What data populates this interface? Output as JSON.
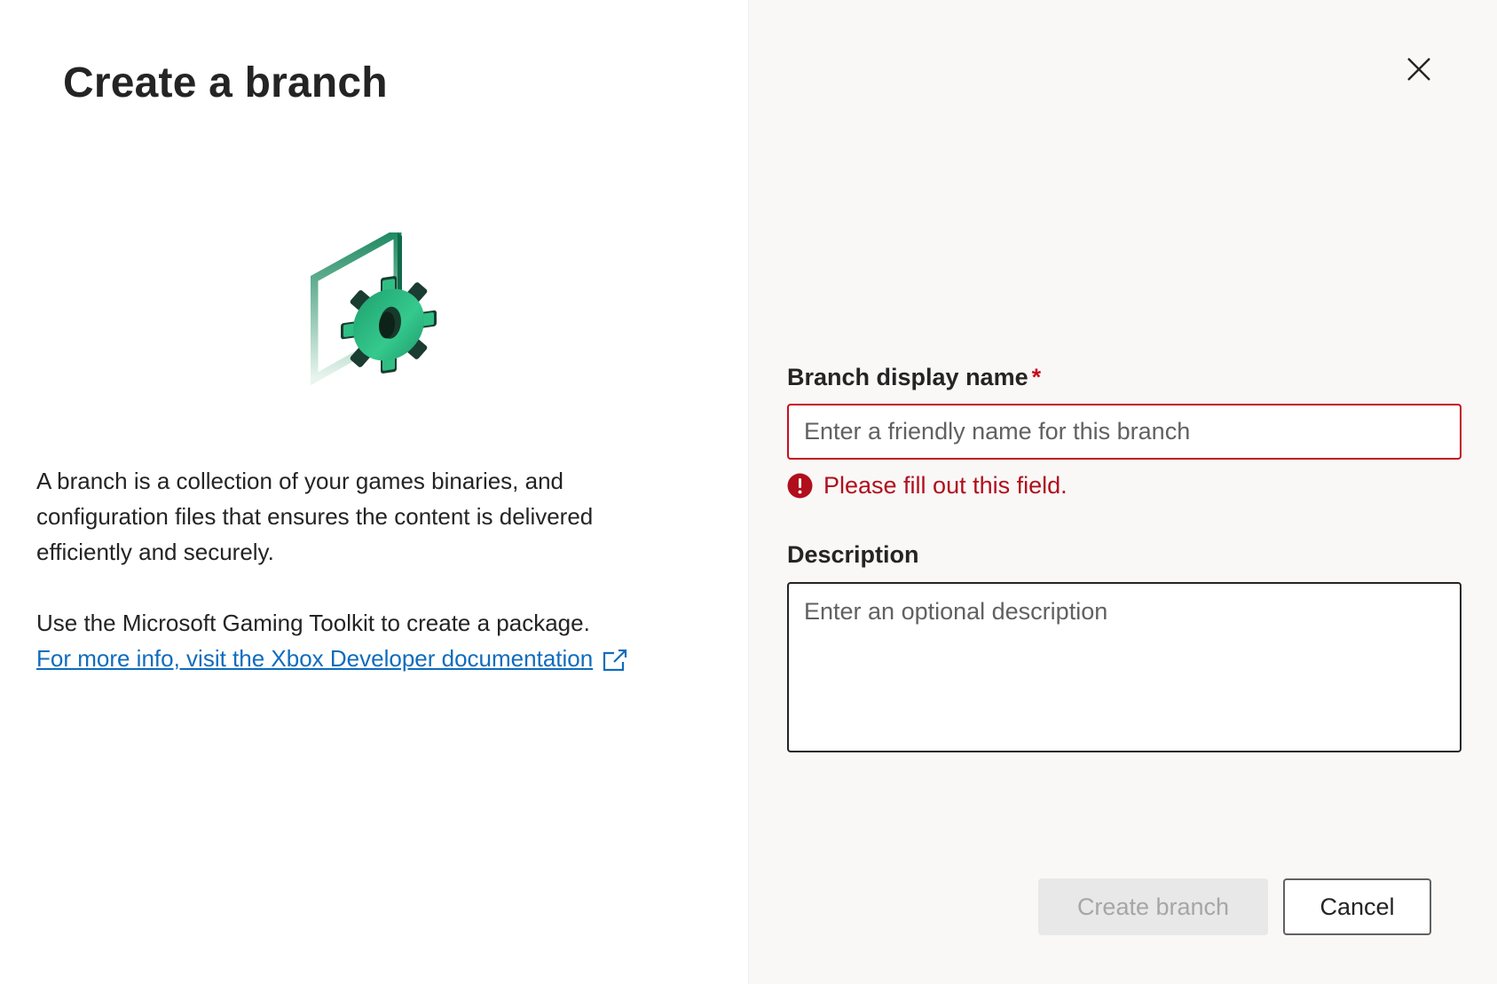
{
  "dialog": {
    "title": "Create a branch",
    "description": "A branch is a collection of your games binaries, and configuration files that ensures the content is delivered efficiently and securely.",
    "toolkit_text": "Use the Microsoft Gaming Toolkit to create a package.",
    "doc_link_text": "For more info, visit the Xbox Developer documentation",
    "illustration_icon": "gear-in-frame-icon",
    "close_icon": "close-icon"
  },
  "form": {
    "name_label": "Branch display name",
    "required_marker": "*",
    "name_placeholder": "Enter a friendly name for this branch",
    "name_value": "",
    "error_message": "Please fill out this field.",
    "error_icon": "error-circle-icon",
    "description_label": "Description",
    "description_placeholder": "Enter an optional description",
    "description_value": ""
  },
  "actions": {
    "create_label": "Create branch",
    "create_disabled": true,
    "cancel_label": "Cancel"
  },
  "colors": {
    "error": "#c50f1f",
    "link": "#0f6cbd",
    "accent_green": "#1f9e6e",
    "right_pane_bg": "#f9f8f7"
  }
}
